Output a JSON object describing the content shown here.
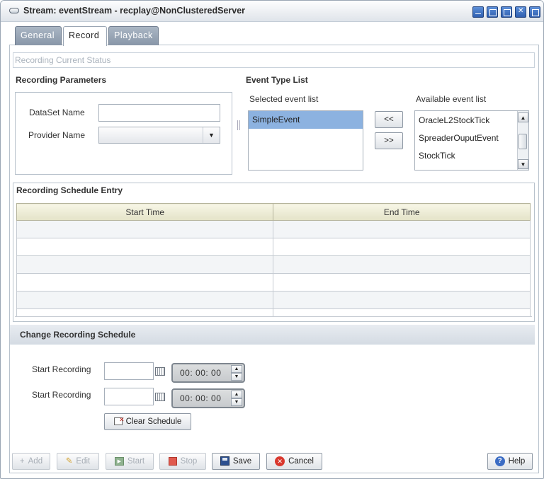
{
  "window": {
    "title": "Stream: eventStream - recplay@NonClusteredServer"
  },
  "tabs": [
    {
      "label": "General"
    },
    {
      "label": "Record"
    },
    {
      "label": "Playback"
    }
  ],
  "status": {
    "text": "Recording Current Status"
  },
  "recording_parameters": {
    "title": "Recording Parameters",
    "dataset_label": "DataSet Name",
    "dataset_value": "",
    "provider_label": "Provider Name",
    "provider_value": ""
  },
  "event_type_list": {
    "title": "Event Type List",
    "selected_label": "Selected event list",
    "available_label": "Available event list",
    "selected": [
      "SimpleEvent"
    ],
    "available": [
      "OracleL2StockTick",
      "SpreaderOuputEvent",
      "StockTick"
    ],
    "move_left_label": "<<",
    "move_right_label": ">>"
  },
  "schedule": {
    "title": "Recording Schedule Entry",
    "columns": [
      "Start Time",
      "End Time"
    ],
    "rows": [
      [
        "",
        ""
      ],
      [
        "",
        ""
      ],
      [
        "",
        ""
      ],
      [
        "",
        ""
      ],
      [
        "",
        ""
      ],
      [
        "",
        ""
      ]
    ]
  },
  "change_schedule": {
    "title": "Change Recording Schedule",
    "rows": [
      {
        "label": "Start Recording",
        "date": "",
        "time": "00: 00: 00"
      },
      {
        "label": "Start Recording",
        "date": "",
        "time": "00: 00: 00"
      }
    ],
    "clear_label": "Clear Schedule"
  },
  "footer": {
    "add": "Add",
    "edit": "Edit",
    "start": "Start",
    "stop": "Stop",
    "save": "Save",
    "cancel": "Cancel",
    "help": "Help"
  }
}
